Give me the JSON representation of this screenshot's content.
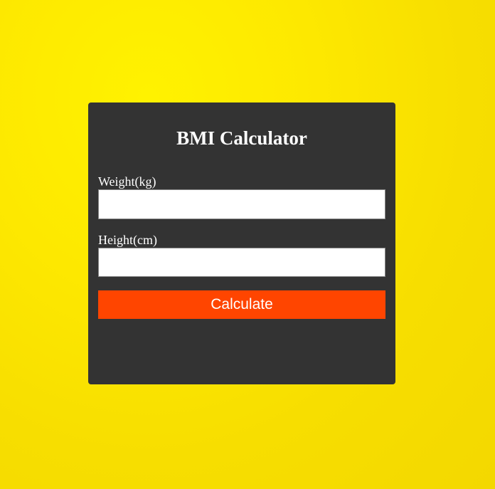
{
  "background_color": "#fde800",
  "card": {
    "background_color": "#333333",
    "title": "BMI Calculator",
    "weight": {
      "label": "Weight(kg)",
      "value": "",
      "placeholder": ""
    },
    "height": {
      "label": "Height(cm)",
      "value": "",
      "placeholder": ""
    },
    "calculate_button": {
      "label": "Calculate",
      "color": "#ff4500"
    },
    "result": ""
  }
}
